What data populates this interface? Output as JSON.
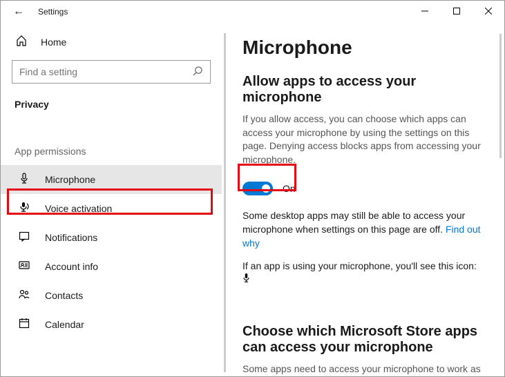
{
  "window": {
    "title": "Settings"
  },
  "sidebar": {
    "home": "Home",
    "search_placeholder": "Find a setting",
    "section": "Privacy",
    "group": "App permissions",
    "items": [
      {
        "icon": "microphone",
        "label": "Microphone",
        "selected": true
      },
      {
        "icon": "voice",
        "label": "Voice activation",
        "selected": false
      },
      {
        "icon": "notifications",
        "label": "Notifications",
        "selected": false
      },
      {
        "icon": "account",
        "label": "Account info",
        "selected": false
      },
      {
        "icon": "contacts",
        "label": "Contacts",
        "selected": false
      },
      {
        "icon": "calendar",
        "label": "Calendar",
        "selected": false
      }
    ]
  },
  "content": {
    "heading": "Microphone",
    "allow_title": "Allow apps to access your microphone",
    "allow_desc": "If you allow access, you can choose which apps can access your microphone by using the settings on this page. Denying access blocks apps from accessing your microphone.",
    "toggle_state": "On",
    "desktop_note_1": "Some desktop apps may still be able to access your microphone when settings on this page are off. ",
    "desktop_note_link": "Find out why",
    "using_note": "If an app is using your microphone, you'll see this icon:",
    "store_title": "Choose which Microsoft Store apps can access your microphone",
    "store_desc": "Some apps need to access your microphone to work as"
  }
}
